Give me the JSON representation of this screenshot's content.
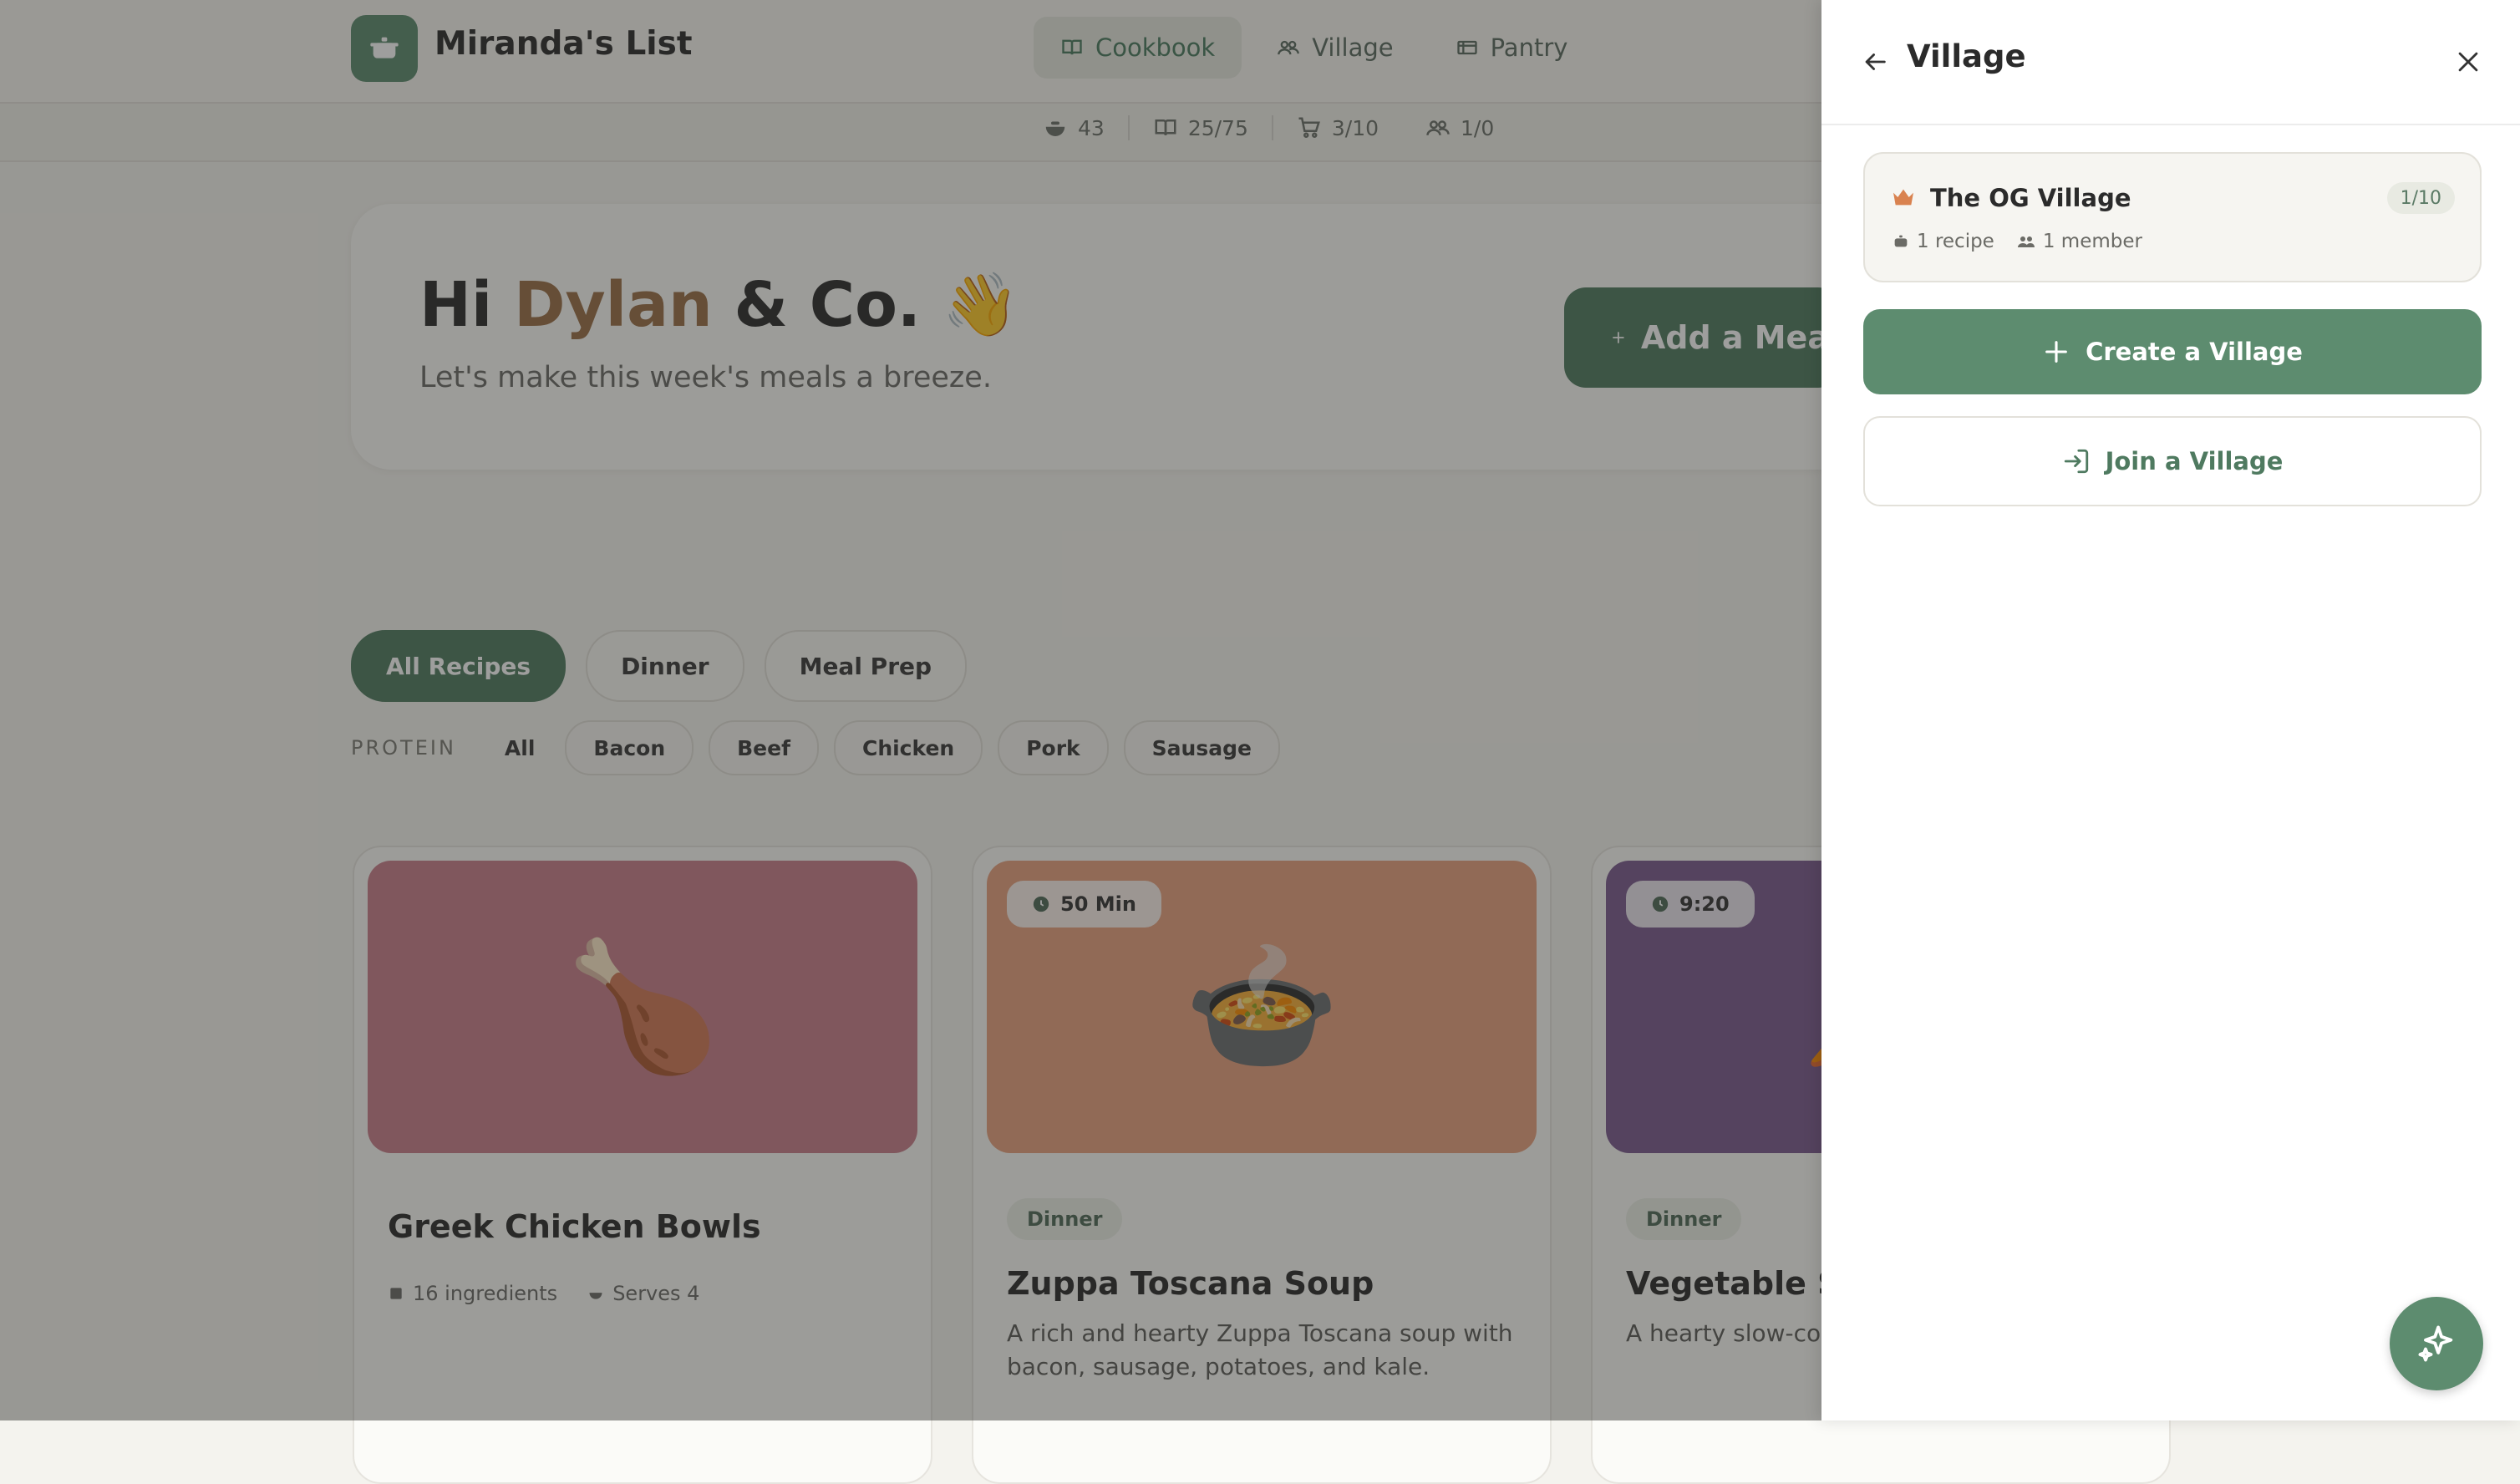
{
  "app": {
    "title": "Miranda's List",
    "nav": [
      {
        "label": "Cookbook",
        "icon": "book-icon",
        "active": true
      },
      {
        "label": "Village",
        "icon": "people-icon",
        "active": false
      },
      {
        "label": "Pantry",
        "icon": "pantry-icon",
        "active": false
      }
    ],
    "stats": [
      {
        "icon": "bowl-icon",
        "value": "43"
      },
      {
        "icon": "book-icon",
        "value": "25/75"
      },
      {
        "icon": "cart-icon",
        "value": "3/10"
      },
      {
        "icon": "people-icon",
        "value": "1/0"
      }
    ]
  },
  "hero": {
    "greeting_prefix": "Hi ",
    "name": "Dylan",
    "greeting_suffix": " & Co.",
    "wave": "👋",
    "subtitle": "Let's make this week's meals a breeze.",
    "add_meal_label": "Add a Meal"
  },
  "filters": {
    "categories": [
      {
        "label": "All Recipes",
        "active": true
      },
      {
        "label": "Dinner",
        "active": false
      },
      {
        "label": "Meal Prep",
        "active": false
      }
    ],
    "protein_label": "PROTEIN",
    "proteins": [
      "All",
      "Bacon",
      "Beef",
      "Chicken",
      "Pork",
      "Sausage"
    ]
  },
  "recipes": [
    {
      "title": "Greek Chicken Bowls",
      "emoji": "🍗",
      "color": "#c97f8a",
      "ingredients": "16 ingredients",
      "serves": "Serves 4"
    },
    {
      "title": "Zuppa Toscana Soup",
      "emoji": "🍲",
      "color": "#e8a17e",
      "time": "50 Min",
      "tag": "Dinner",
      "description": "A rich and hearty Zuppa Toscana soup with bacon, sausage, potatoes, and kale."
    },
    {
      "title": "Vegetable So",
      "emoji": "🥕",
      "color": "#7a5a8f",
      "time": "9:20",
      "tag": "Dinner",
      "description": "A hearty slow-coo stew meat."
    }
  ],
  "drawer": {
    "title": "Village",
    "village": {
      "name": "The OG Village",
      "count": "1/10",
      "recipes": "1 recipe",
      "members": "1 member"
    },
    "create_label": "Create a Village",
    "join_label": "Join a Village"
  },
  "colors": {
    "accent": "#5d8c6f",
    "accent_dark": "#4f7a60",
    "name": "#9a6e45"
  }
}
